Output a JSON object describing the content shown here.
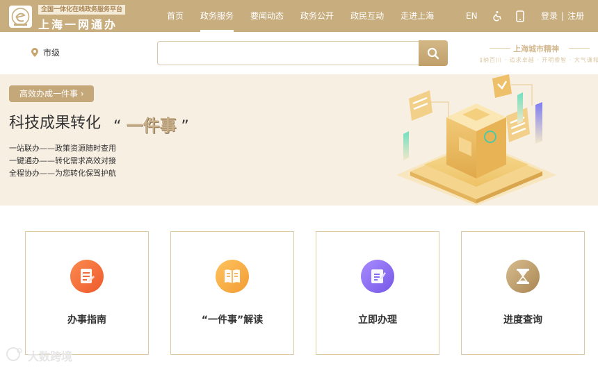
{
  "header": {
    "platform_tag": "全国一体化在线政务服务平台",
    "site_name": "上海一网通办",
    "nav": [
      "首页",
      "政务服务",
      "要闻动态",
      "政务公开",
      "政民互动",
      "走进上海"
    ],
    "active_nav": "政务服务",
    "lang": "EN",
    "login": "登录",
    "register": "注册",
    "separator": "|"
  },
  "location": {
    "label": "市级"
  },
  "search": {
    "value": "",
    "placeholder": ""
  },
  "spirit": {
    "title": "上海城市精神",
    "subtitle": "海纳百川 · 追求卓越 · 开明睿智 · 大气谦和"
  },
  "banner": {
    "pill": "高效办成一件事 ›",
    "title": "科技成果转化",
    "quote_open": "“",
    "quote_text": "一件事",
    "quote_close": "”",
    "lines": [
      "一站联办——政策资源随时查用",
      "一键通办——转化需求高效对接",
      "全程协办——为您转化保驾护航"
    ]
  },
  "cards": [
    {
      "label": "办事指南",
      "icon": "guide-icon",
      "color": "#f26b3a"
    },
    {
      "label": "“一件事”解读",
      "icon": "book-icon",
      "color": "#f5a33c"
    },
    {
      "label": "立即办理",
      "icon": "apply-icon",
      "color": "#8a6cf0"
    },
    {
      "label": "进度查询",
      "icon": "hourglass-icon",
      "color": "#b79868"
    }
  ],
  "watermark": "大数跨境",
  "colors": {
    "header": "#c8ad7f",
    "banner_bg": "#f8efe3",
    "card_border": "#dfc9a3"
  }
}
